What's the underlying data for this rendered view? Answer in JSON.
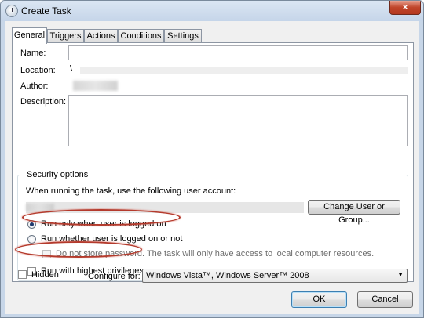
{
  "window": {
    "title": "Create Task",
    "close_symbol": "×"
  },
  "tabs": [
    {
      "label": "General",
      "active": true
    },
    {
      "label": "Triggers",
      "active": false
    },
    {
      "label": "Actions",
      "active": false
    },
    {
      "label": "Conditions",
      "active": false
    },
    {
      "label": "Settings",
      "active": false
    }
  ],
  "general": {
    "name_label": "Name:",
    "name_value": "",
    "location_label": "Location:",
    "location_value": "\\",
    "author_label": "Author:",
    "description_label": "Description:",
    "description_value": ""
  },
  "security": {
    "group_title": "Security options",
    "account_prompt": "When running the task, use the following user account:",
    "change_user_button": "Change User or Group...",
    "radio_logged_on": "Run only when user is logged on",
    "radio_whether": "Run whether user is logged on or not",
    "no_store_password": "Do not store password.  The task will only have access to local computer resources.",
    "highest_privileges": "Run with highest privileges",
    "selected_option": "Run only when user is logged on"
  },
  "bottom": {
    "hidden_label": "Hidden",
    "configure_label": "Configure for:",
    "configure_value": "Windows Vista™, Windows Server™ 2008",
    "ok_button": "OK",
    "cancel_button": "Cancel"
  },
  "colors": {
    "annotation": "#b43a2c",
    "selection": "#3c7fb1"
  }
}
